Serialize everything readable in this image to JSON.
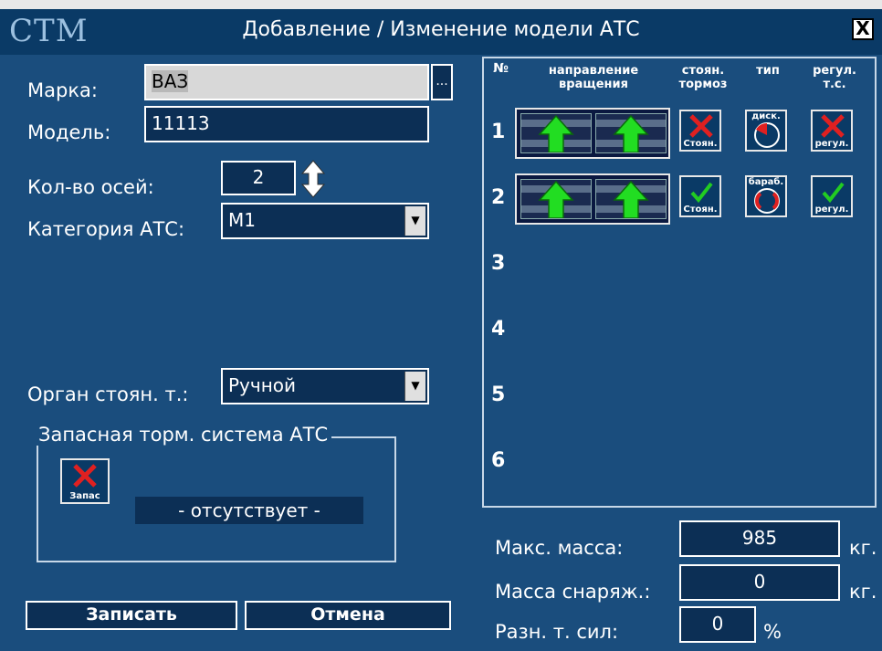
{
  "window": {
    "logo": "СТМ",
    "title": "Добавление / Изменение модели АТС",
    "close_label": "X"
  },
  "form": {
    "brand_label": "Марка:",
    "brand_value": "ВАЗ",
    "brand_browse": "...",
    "model_label": "Модель:",
    "model_value": "11113",
    "axles_label": "Кол-во осей:",
    "axles_value": "2",
    "category_label": "Категория АТС:",
    "category_value": "M1",
    "parking_label": "Орган стоян. т.:",
    "parking_value": "Ручной"
  },
  "reserve": {
    "group_title": "Запасная торм. система АТС",
    "icon_caption": "Запас",
    "status": "- отсутствует -"
  },
  "buttons": {
    "save": "Записать",
    "cancel": "Отмена"
  },
  "axle_table": {
    "headers": {
      "num": "№",
      "rotation_1": "направление",
      "rotation_2": "вращения",
      "parking_1": "стоян.",
      "parking_2": "тормоз",
      "type": "тип",
      "adjust_1": "регул.",
      "adjust_2": "т.с."
    },
    "rows": [
      {
        "num": "1",
        "parking_caption": "Стоян.",
        "parking_state": "off",
        "type_caption": "диск.",
        "adjust_caption": "регул.",
        "adjust_state": "off"
      },
      {
        "num": "2",
        "parking_caption": "Стоян.",
        "parking_state": "on",
        "type_caption": "бараб.",
        "adjust_caption": "регул.",
        "adjust_state": "on"
      },
      {
        "num": "3"
      },
      {
        "num": "4"
      },
      {
        "num": "5"
      },
      {
        "num": "6"
      }
    ]
  },
  "mass": {
    "max_label": "Макс. масса:",
    "max_value": "985",
    "curb_label": "Масса снаряж.:",
    "curb_value": "0",
    "diff_label": "Разн. т. сил:",
    "diff_value": "0",
    "unit_kg": "кг.",
    "unit_pct": "%"
  },
  "colors": {
    "background": "#1a4d7d",
    "field": "#0c2f55",
    "arrow_green": "#22dd22",
    "cross_red": "#e02020",
    "check_green": "#22cc22"
  },
  "icons": {
    "up_arrow": "up-arrow-icon",
    "cross": "cross-icon",
    "check": "check-icon",
    "disc": "disc-brake-icon",
    "drum": "drum-brake-icon"
  }
}
